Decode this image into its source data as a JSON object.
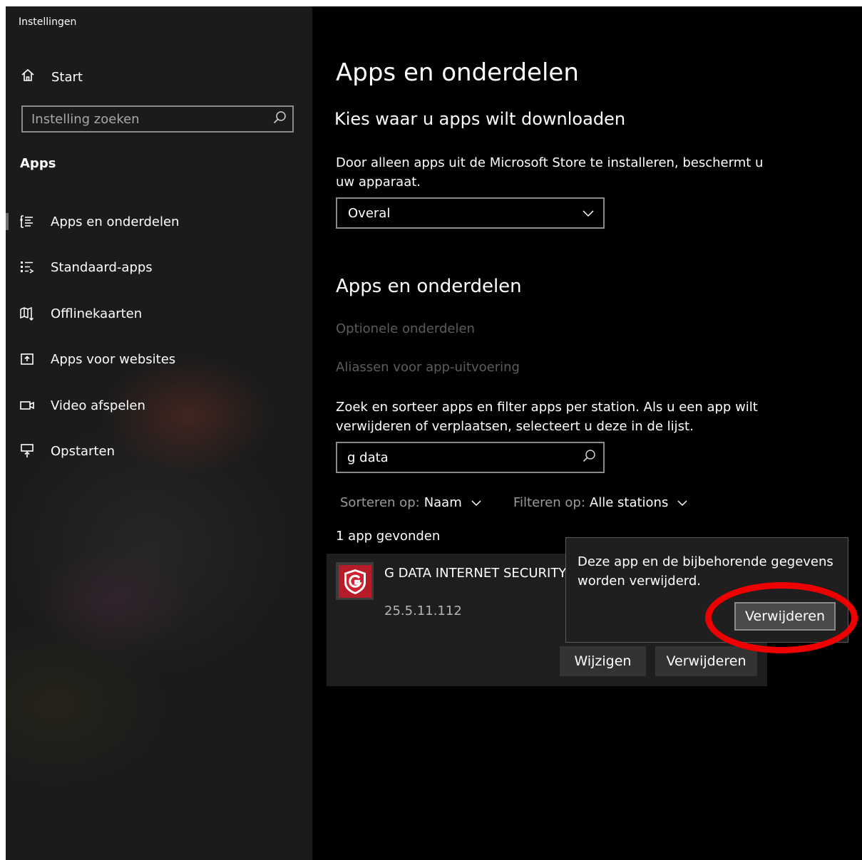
{
  "window": {
    "title": "Instellingen"
  },
  "sidebar": {
    "home_label": "Start",
    "search_placeholder": "Instelling zoeken",
    "section": "Apps",
    "items": [
      {
        "label": "Apps en onderdelen",
        "icon": "apps-features-icon",
        "selected": true
      },
      {
        "label": "Standaard-apps",
        "icon": "default-apps-icon"
      },
      {
        "label": "Offlinekaarten",
        "icon": "offline-maps-icon"
      },
      {
        "label": "Apps voor websites",
        "icon": "apps-for-websites-icon"
      },
      {
        "label": "Video afspelen",
        "icon": "video-playback-icon"
      },
      {
        "label": "Opstarten",
        "icon": "startup-icon"
      }
    ]
  },
  "main": {
    "title": "Apps en onderdelen",
    "download_heading": "Kies waar u apps wilt downloaden",
    "download_description": "Door alleen apps uit de Microsoft Store te installeren, beschermt u uw apparaat.",
    "download_select_value": "Overal",
    "apps_heading": "Apps en onderdelen",
    "optional_features_link": "Optionele onderdelen",
    "aliases_link": "Aliassen voor app-uitvoering",
    "search_description": "Zoek en sorteer apps en filter apps per station. Als u een app wilt verwijderen of verplaatsen, selecteert u deze in de lijst.",
    "search_value": "g data",
    "sort_label": "Sorteren op:",
    "sort_value": "Naam",
    "filter_label": "Filteren op:",
    "filter_value": "Alle stations",
    "found_count": "1 app gevonden",
    "app": {
      "name": "G DATA INTERNET SECURITY",
      "version": "25.5.11.112",
      "icon": "g-data-logo-icon",
      "modify_label": "Wijzigen",
      "uninstall_label": "Verwijderen"
    },
    "flyout": {
      "message": "Deze app en de bijbehorende gegevens worden verwijderd.",
      "confirm_label": "Verwijderen"
    }
  },
  "colors": {
    "sidebar_bg": "#1b1b1b",
    "main_bg": "#000000",
    "card_bg": "#1e1e1e",
    "button_bg": "#333333",
    "highlight_ring": "#ee0000",
    "g_data_red": "#d1202f"
  }
}
